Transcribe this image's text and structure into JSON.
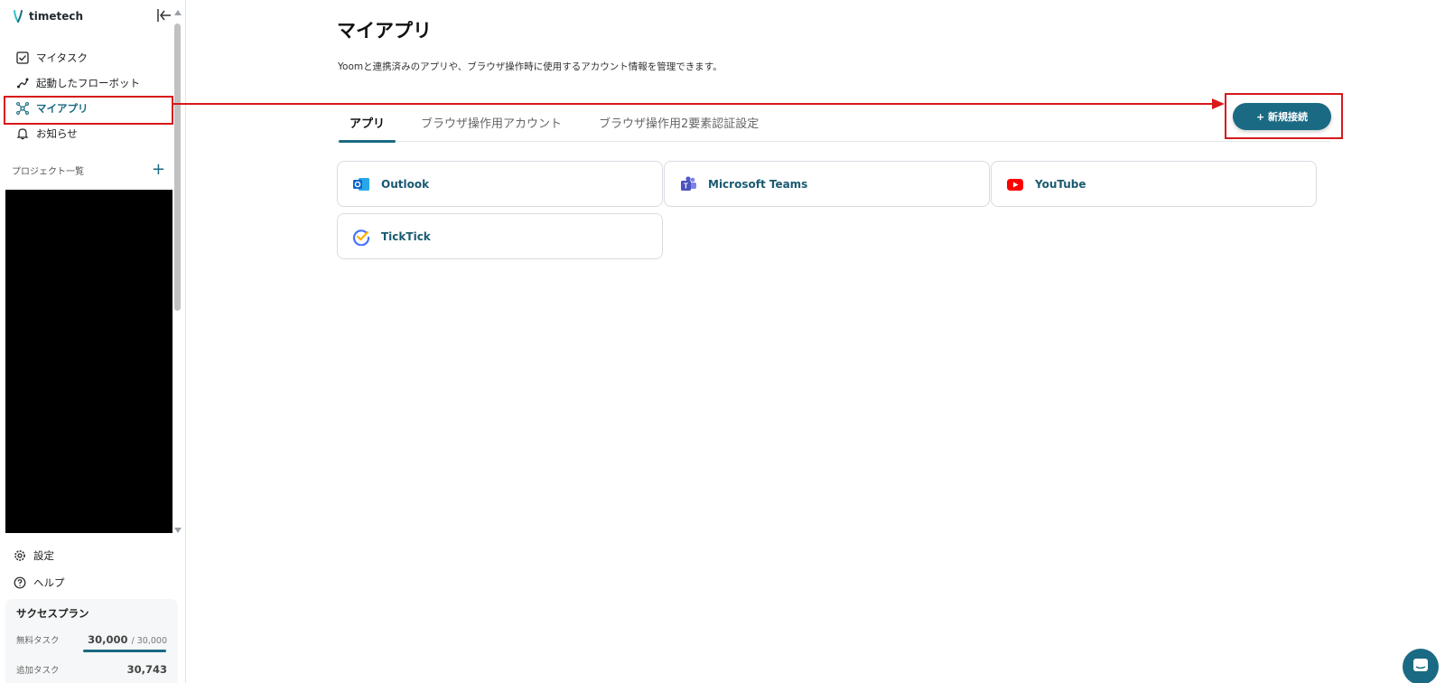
{
  "brand": {
    "name": "timetech"
  },
  "sidebar": {
    "items": [
      {
        "label": "マイタスク",
        "icon": "checkbox-icon"
      },
      {
        "label": "起動したフローボット",
        "icon": "flow-icon"
      },
      {
        "label": "マイアプリ",
        "icon": "apps-network-icon",
        "active": true
      },
      {
        "label": "お知らせ",
        "icon": "bell-icon"
      }
    ],
    "project_header": "プロジェクト一覧",
    "project_add": "+",
    "bottom_items": [
      {
        "label": "設定",
        "icon": "gear-icon"
      },
      {
        "label": "ヘルプ",
        "icon": "help-icon"
      }
    ],
    "plan": {
      "title": "サクセスプラン",
      "free_label": "無料タスク",
      "free_value": "30,000",
      "free_total": "/ 30,000",
      "free_progress": 1.0,
      "extra_label": "追加タスク",
      "extra_value": "30,743"
    }
  },
  "main": {
    "title": "マイアプリ",
    "description": "Yoomと連携済みのアプリや、ブラウザ操作時に使用するアカウント情報を管理できます。",
    "tabs": [
      {
        "label": "アプリ",
        "active": true
      },
      {
        "label": "ブラウザ操作用アカウント"
      },
      {
        "label": "ブラウザ操作用2要素認証設定"
      }
    ],
    "new_button": "+ 新規接続",
    "apps": [
      {
        "label": "Outlook",
        "icon": "outlook-icon"
      },
      {
        "label": "Microsoft Teams",
        "icon": "teams-icon"
      },
      {
        "label": "YouTube",
        "icon": "youtube-icon"
      },
      {
        "label": "TickTick",
        "icon": "ticktick-icon"
      }
    ]
  },
  "colors": {
    "accent": "#1a6a83",
    "highlight": "#d7191c"
  }
}
